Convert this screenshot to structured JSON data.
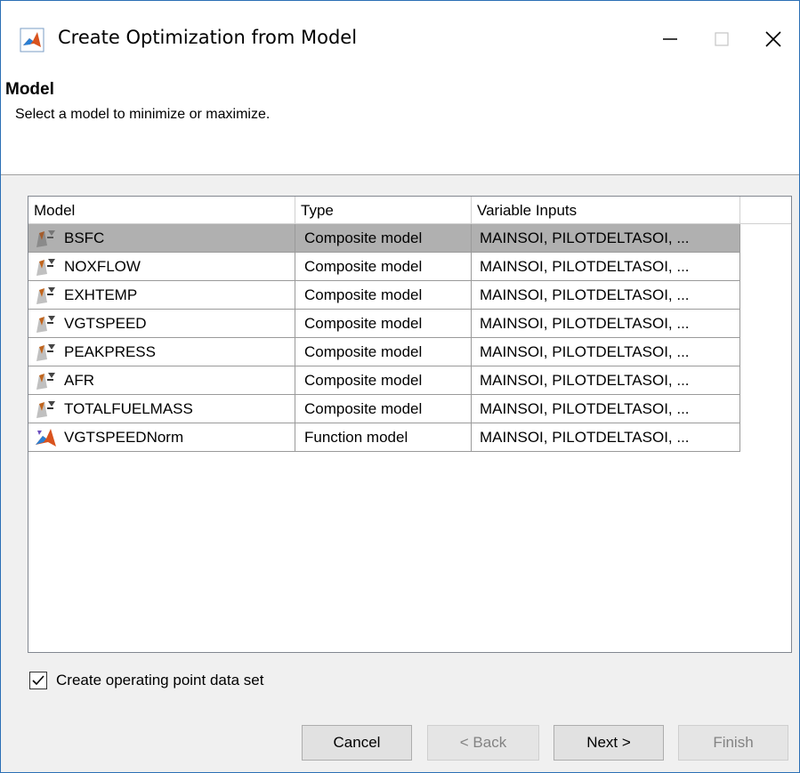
{
  "window": {
    "title": "Create Optimization from Model"
  },
  "header": {
    "section_title": "Model",
    "description": "Select a model to minimize or maximize."
  },
  "table": {
    "columns": [
      "Model",
      "Type",
      "Variable Inputs"
    ],
    "rows": [
      {
        "icon": "composite-model-icon",
        "model": "BSFC",
        "type": "Composite model",
        "inputs": "MAINSOI, PILOTDELTASOI, ...",
        "selected": true
      },
      {
        "icon": "composite-model-icon",
        "model": "NOXFLOW",
        "type": "Composite model",
        "inputs": "MAINSOI, PILOTDELTASOI, ..."
      },
      {
        "icon": "composite-model-icon",
        "model": "EXHTEMP",
        "type": "Composite model",
        "inputs": "MAINSOI, PILOTDELTASOI, ..."
      },
      {
        "icon": "composite-model-icon",
        "model": "VGTSPEED",
        "type": "Composite model",
        "inputs": "MAINSOI, PILOTDELTASOI, ..."
      },
      {
        "icon": "composite-model-icon",
        "model": "PEAKPRESS",
        "type": "Composite model",
        "inputs": "MAINSOI, PILOTDELTASOI, ..."
      },
      {
        "icon": "composite-model-icon",
        "model": "AFR",
        "type": "Composite model",
        "inputs": "MAINSOI, PILOTDELTASOI, ..."
      },
      {
        "icon": "composite-model-icon",
        "model": "TOTALFUELMASS",
        "type": "Composite model",
        "inputs": "MAINSOI, PILOTDELTASOI, ..."
      },
      {
        "icon": "function-model-icon",
        "model": "VGTSPEEDNorm",
        "type": "Function model",
        "inputs": "MAINSOI, PILOTDELTASOI, ..."
      }
    ]
  },
  "options": {
    "create_dataset_label": "Create operating point data set",
    "create_dataset_checked": true
  },
  "buttons": {
    "cancel": "Cancel",
    "back": "< Back",
    "next": "Next >",
    "finish": "Finish"
  },
  "colors": {
    "selected_row": "#b0b0b0",
    "window_border": "#2b6fb5"
  }
}
